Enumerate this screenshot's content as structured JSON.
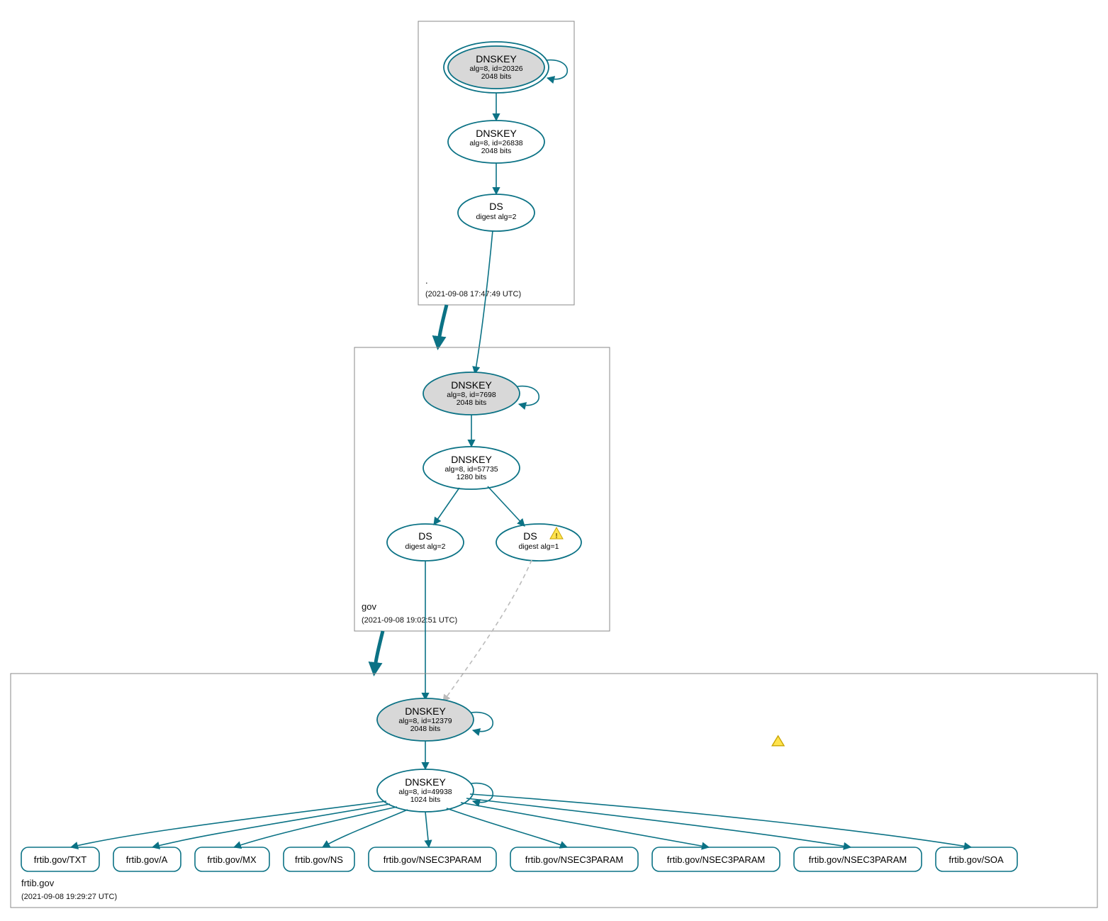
{
  "colors": {
    "accent": "#0b7285",
    "ksk_fill": "#d8d8d8",
    "warn": "#ffe34d"
  },
  "zones": {
    "root": {
      "name": ".",
      "timestamp": "(2021-09-08 17:47:49 UTC)"
    },
    "gov": {
      "name": "gov",
      "timestamp": "(2021-09-08 19:02:51 UTC)"
    },
    "frtib": {
      "name": "frtib.gov",
      "timestamp": "(2021-09-08 19:29:27 UTC)"
    }
  },
  "nodes": {
    "root_ksk": {
      "title": "DNSKEY",
      "line2": "alg=8, id=20326",
      "line3": "2048 bits"
    },
    "root_zsk": {
      "title": "DNSKEY",
      "line2": "alg=8, id=26838",
      "line3": "2048 bits"
    },
    "root_ds": {
      "title": "DS",
      "line2": "digest alg=2"
    },
    "gov_ksk": {
      "title": "DNSKEY",
      "line2": "alg=8, id=7698",
      "line3": "2048 bits"
    },
    "gov_zsk": {
      "title": "DNSKEY",
      "line2": "alg=8, id=57735",
      "line3": "1280 bits"
    },
    "gov_ds_a": {
      "title": "DS",
      "line2": "digest alg=2"
    },
    "gov_ds_b": {
      "title": "DS",
      "line2": "digest alg=1"
    },
    "frtib_ksk": {
      "title": "DNSKEY",
      "line2": "alg=8, id=12379",
      "line3": "2048 bits"
    },
    "frtib_zsk": {
      "title": "DNSKEY",
      "line2": "alg=8, id=49938",
      "line3": "1024 bits"
    }
  },
  "rrsets": [
    "frtib.gov/TXT",
    "frtib.gov/A",
    "frtib.gov/MX",
    "frtib.gov/NS",
    "frtib.gov/NSEC3PARAM",
    "frtib.gov/NSEC3PARAM",
    "frtib.gov/NSEC3PARAM",
    "frtib.gov/NSEC3PARAM",
    "frtib.gov/SOA"
  ]
}
